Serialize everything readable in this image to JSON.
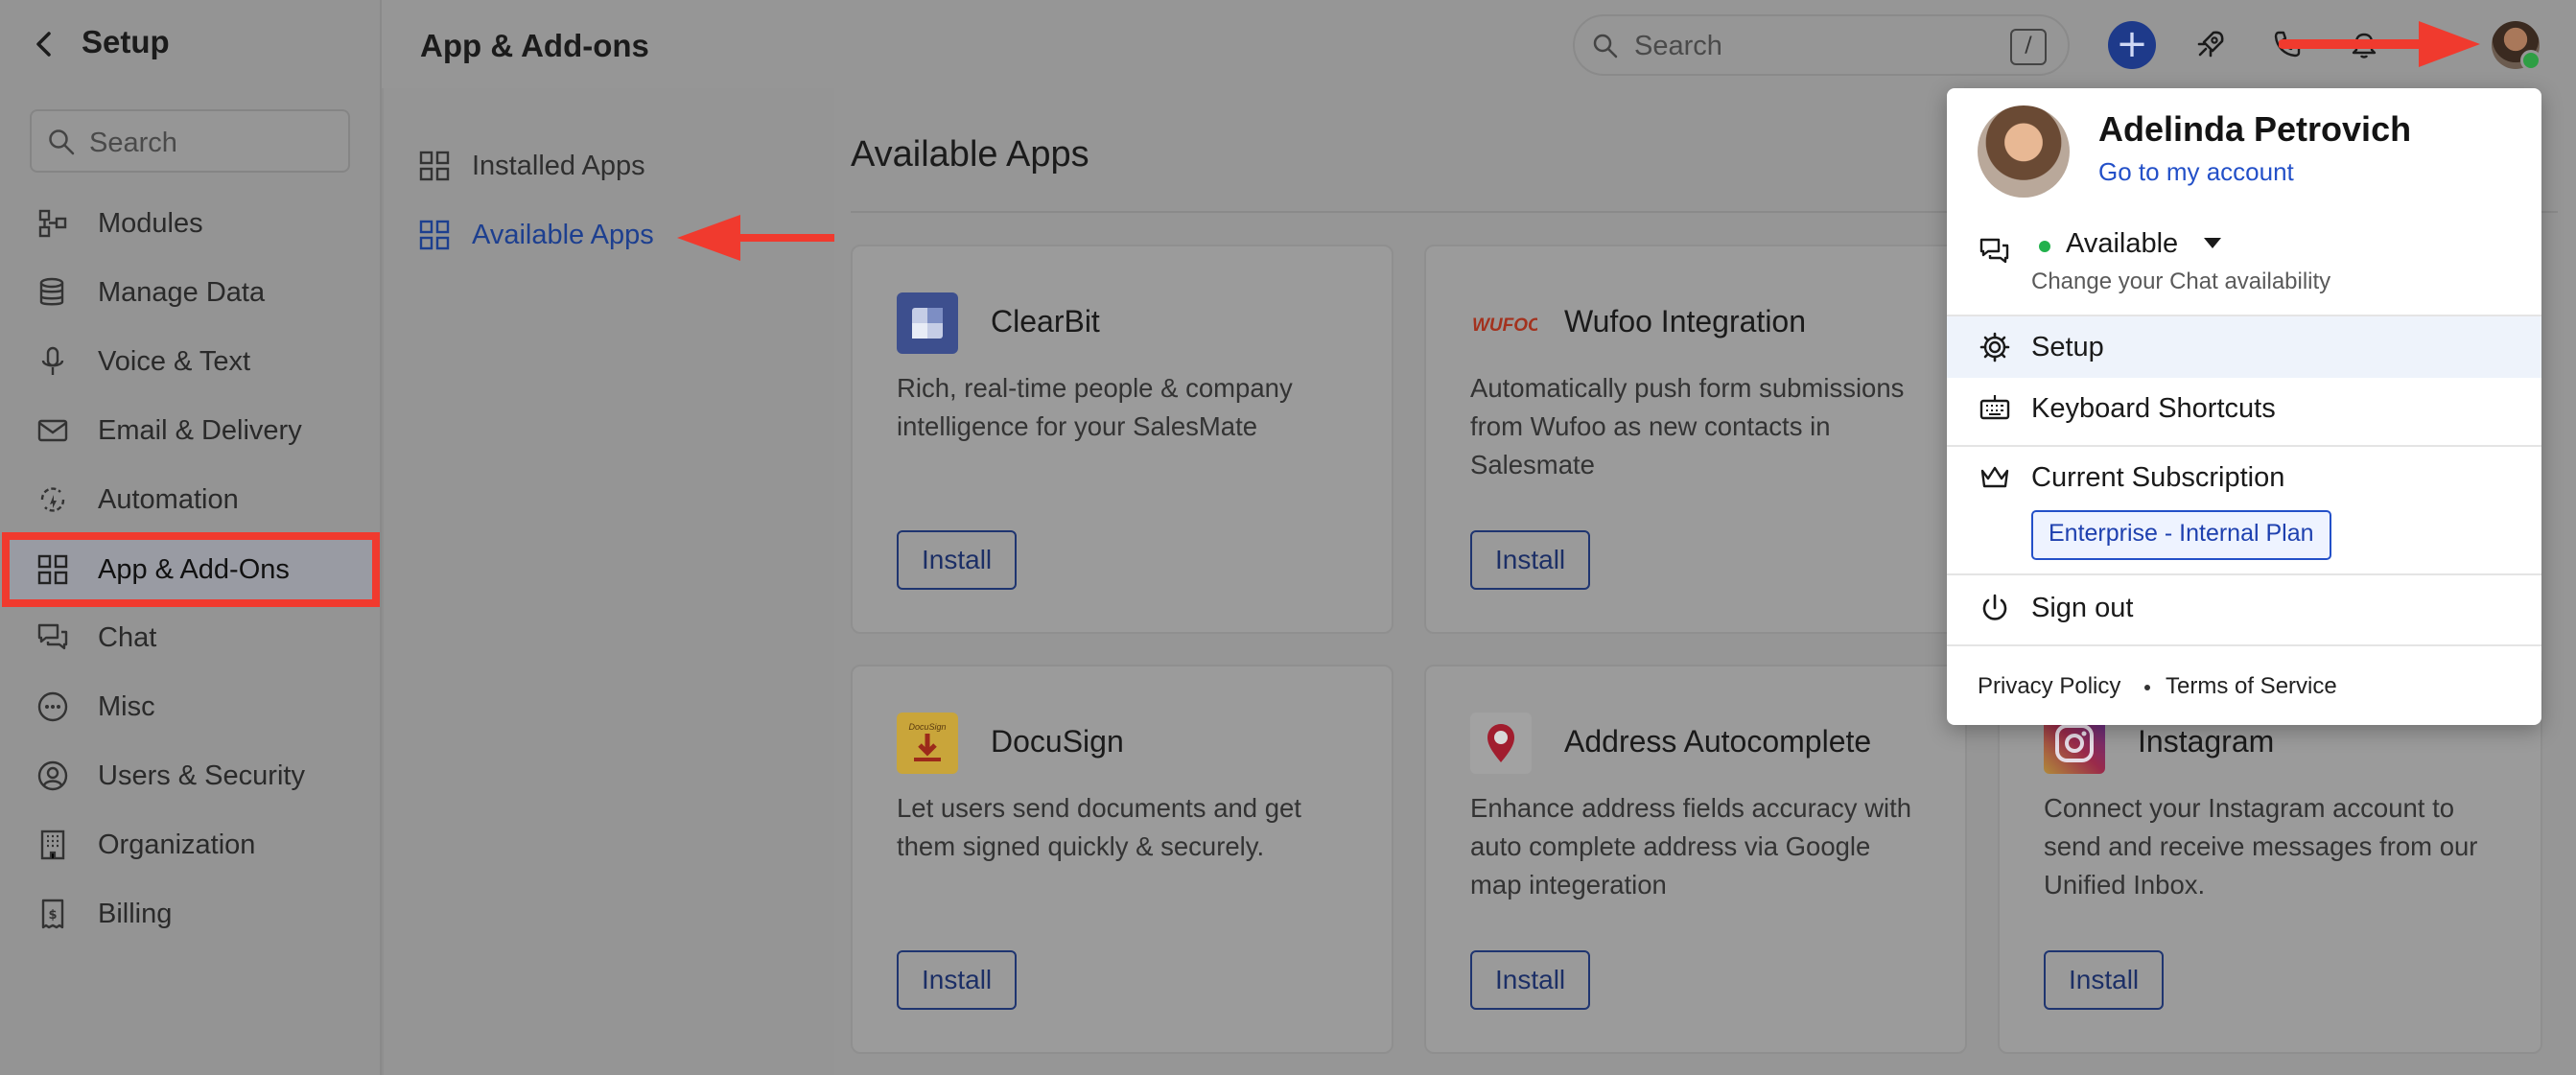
{
  "header": {
    "setup_title": "Setup",
    "page_title": "App & Add-ons",
    "search_placeholder": "Search",
    "search_shortcut": "/"
  },
  "sidebar": {
    "search_placeholder": "Search",
    "items": [
      {
        "label": "Modules",
        "icon": "modules-icon"
      },
      {
        "label": "Manage Data",
        "icon": "database-icon"
      },
      {
        "label": "Voice & Text",
        "icon": "microphone-icon"
      },
      {
        "label": "Email & Delivery",
        "icon": "envelope-icon"
      },
      {
        "label": "Automation",
        "icon": "automation-icon"
      },
      {
        "label": "App & Add-Ons",
        "icon": "grid-icon",
        "active": true
      },
      {
        "label": "Chat",
        "icon": "chat-icon"
      },
      {
        "label": "Misc",
        "icon": "dots-circle-icon"
      },
      {
        "label": "Users & Security",
        "icon": "user-circle-icon"
      },
      {
        "label": "Organization",
        "icon": "building-icon"
      },
      {
        "label": "Billing",
        "icon": "invoice-icon"
      }
    ]
  },
  "subnav": {
    "items": [
      {
        "label": "Installed Apps"
      },
      {
        "label": "Available Apps",
        "active": true
      }
    ]
  },
  "main": {
    "title": "Available Apps",
    "cards": [
      {
        "name": "ClearBit",
        "desc": "Rich, real-time people & company intelligence for your SalesMate",
        "button": "Install",
        "icon": "clearbit-logo"
      },
      {
        "name": "Wufoo Integration",
        "desc": "Automatically push form submissions from Wufoo as new contacts in Salesmate",
        "button": "Install",
        "icon": "wufoo-logo",
        "logo_text": "WUFOO"
      },
      {
        "name": "DocuSign",
        "desc": "Let users send documents and get them signed quickly & securely.",
        "button": "Install",
        "icon": "docusign-logo",
        "logo_text": "DocuSign"
      },
      {
        "name": "Address Autocomplete",
        "desc": "Enhance address fields accuracy with auto complete address via Google map integeration",
        "button": "Install",
        "icon": "map-pin-logo"
      },
      {
        "name": "Instagram",
        "desc": "Connect your Instagram account to send and receive messages from our Unified Inbox.",
        "button": "Install",
        "icon": "instagram-logo"
      }
    ]
  },
  "user_menu": {
    "name": "Adelinda Petrovich",
    "account_link": "Go to my account",
    "availability": "Available",
    "availability_sub": "Change your Chat availability",
    "setup": "Setup",
    "shortcuts": "Keyboard Shortcuts",
    "subscription_label": "Current Subscription",
    "plan": "Enterprise - Internal Plan",
    "sign_out": "Sign out",
    "privacy": "Privacy Policy",
    "terms": "Terms of Service"
  },
  "colors": {
    "accent": "#2350c8",
    "annotation": "#f03a2e",
    "available": "#22b14c"
  }
}
